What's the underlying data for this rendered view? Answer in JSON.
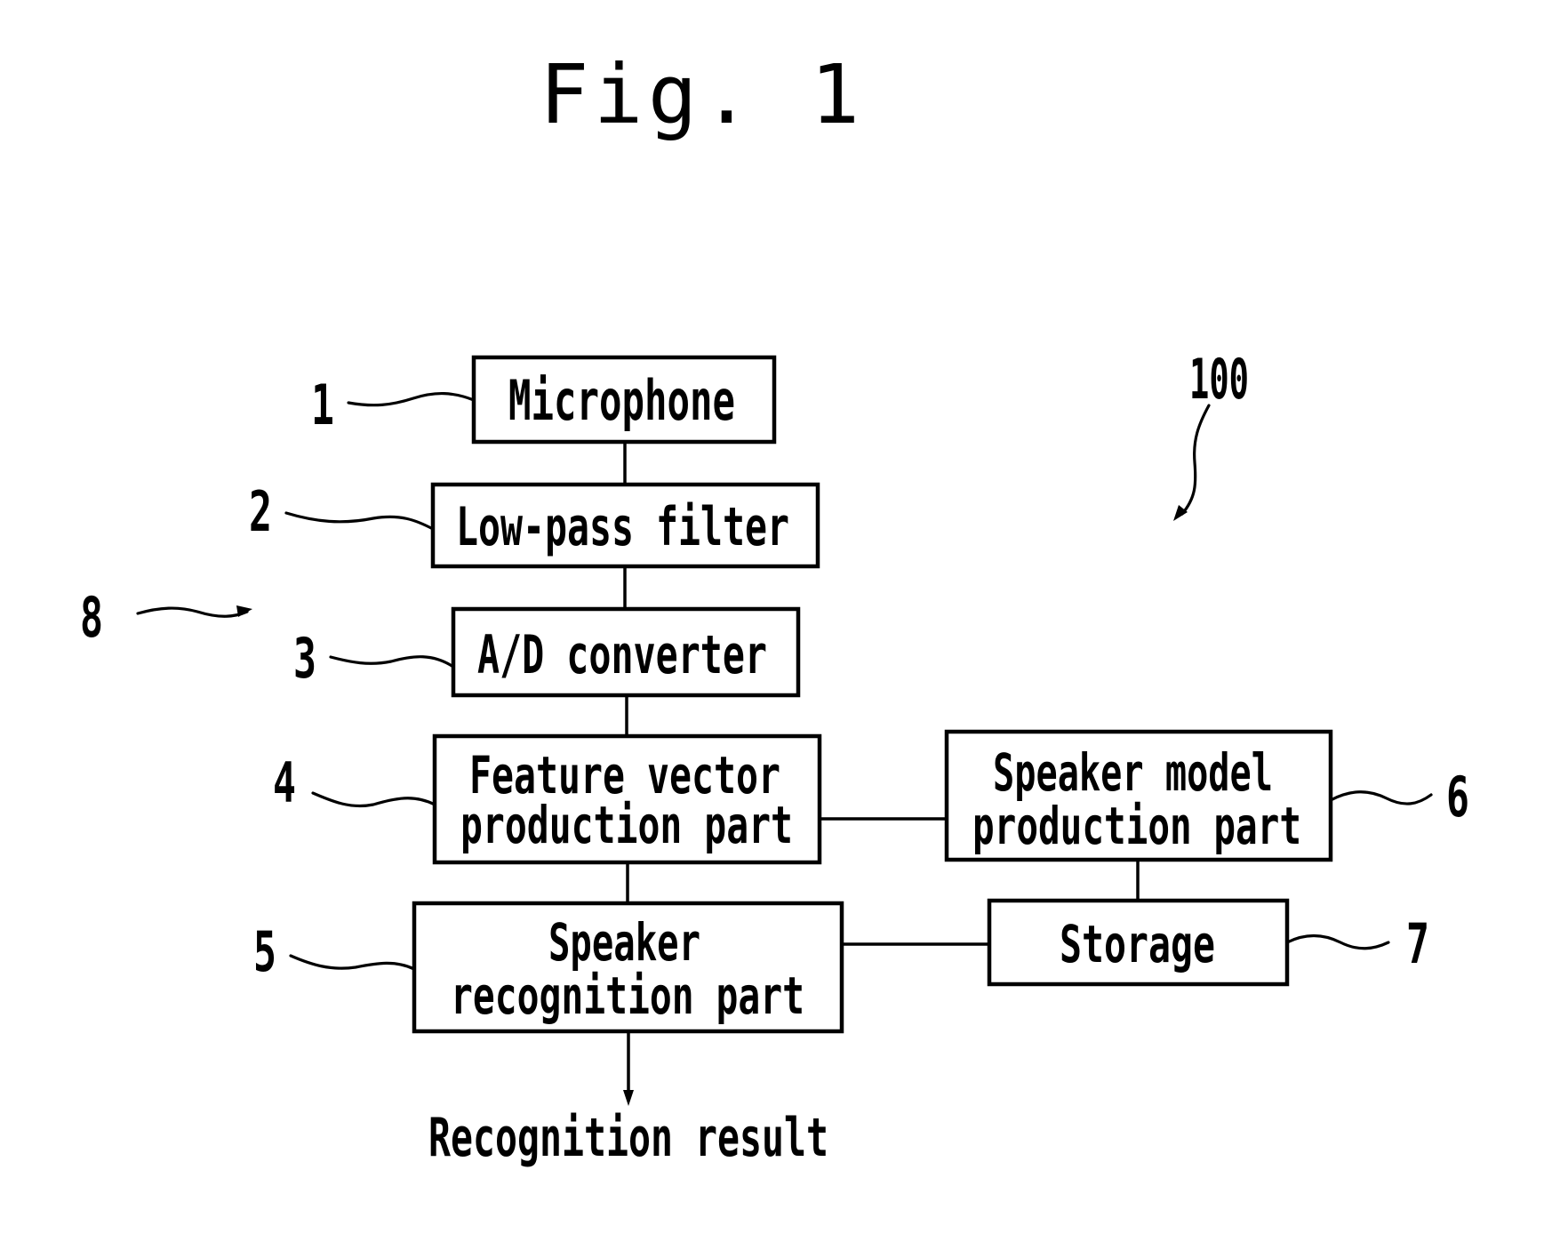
{
  "figure": {
    "title": "Fig. 1",
    "system_ref": "100",
    "group_ref": "8"
  },
  "blocks": {
    "microphone": {
      "ref": "1",
      "lines": [
        "Microphone"
      ]
    },
    "low_pass_filter": {
      "ref": "2",
      "lines": [
        "Low-pass filter"
      ]
    },
    "ad_converter": {
      "ref": "3",
      "lines": [
        "A/D converter"
      ]
    },
    "feature_vector": {
      "ref": "4",
      "lines": [
        "Feature vector",
        "production part"
      ]
    },
    "speaker_recognition": {
      "ref": "5",
      "lines": [
        "Speaker",
        "recognition part"
      ]
    },
    "speaker_model": {
      "ref": "6",
      "lines": [
        "Speaker model",
        "production part"
      ]
    },
    "storage": {
      "ref": "7",
      "lines": [
        "Storage"
      ]
    }
  },
  "output": {
    "label": "Recognition result"
  },
  "connections": [
    [
      "microphone",
      "low_pass_filter"
    ],
    [
      "low_pass_filter",
      "ad_converter"
    ],
    [
      "ad_converter",
      "feature_vector"
    ],
    [
      "feature_vector",
      "speaker_recognition"
    ],
    [
      "feature_vector",
      "speaker_model"
    ],
    [
      "speaker_model",
      "storage"
    ],
    [
      "storage",
      "speaker_recognition"
    ],
    [
      "speaker_recognition",
      "output"
    ]
  ]
}
